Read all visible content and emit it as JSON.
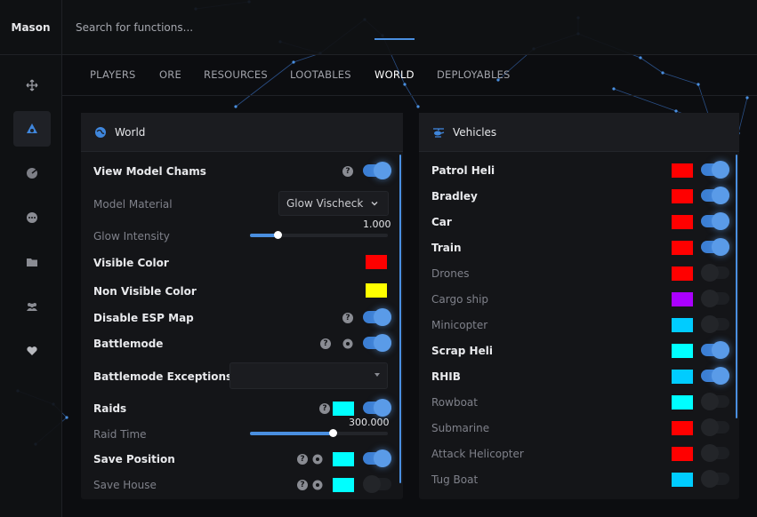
{
  "brand": "Mason",
  "search": {
    "placeholder": "Search for functions..."
  },
  "sidebar": {
    "items": [
      {
        "icon": "move-icon",
        "active": false
      },
      {
        "icon": "eye-icon",
        "active": true
      },
      {
        "icon": "radar-icon",
        "active": false
      },
      {
        "icon": "dots-icon",
        "active": false
      },
      {
        "icon": "folder-icon",
        "active": false
      },
      {
        "icon": "users-icon",
        "active": false
      },
      {
        "icon": "heart-icon",
        "active": false
      }
    ]
  },
  "tabs": [
    "PLAYERS",
    "ORE",
    "RESOURCES",
    "LOOTABLES",
    "WORLD",
    "DEPLOYABLES"
  ],
  "active_tab": "WORLD",
  "colors": {
    "accent": "#4a8fe0",
    "red": "#ff0000",
    "yellow": "#ffff00",
    "cyan": "#00ffff",
    "light_cyan": "#00ccff",
    "purple": "#aa00ff"
  },
  "world": {
    "title": "World",
    "view_model_chams": "View Model Chams",
    "model_material": "Model Material",
    "model_material_value": "Glow Vischeck",
    "glow_intensity": "Glow Intensity",
    "glow_intensity_value": "1.000",
    "glow_intensity_fraction": 0.2,
    "visible_color": "Visible Color",
    "non_visible_color": "Non Visible Color",
    "disable_esp_map": "Disable ESP Map",
    "battlemode": "Battlemode",
    "battlemode_exceptions": "Battlemode Exceptions",
    "raids": "Raids",
    "raid_time": "Raid Time",
    "raid_time_value": "300.000",
    "raid_time_fraction": 0.6,
    "save_position": "Save Position",
    "save_house": "Save House"
  },
  "vehicles": {
    "title": "Vehicles",
    "items": [
      {
        "label": "Patrol Heli",
        "color": "#ff0000",
        "enabled": true
      },
      {
        "label": "Bradley",
        "color": "#ff0000",
        "enabled": true
      },
      {
        "label": "Car",
        "color": "#ff0000",
        "enabled": true
      },
      {
        "label": "Train",
        "color": "#ff0000",
        "enabled": true
      },
      {
        "label": "Drones",
        "color": "#ff0000",
        "enabled": false
      },
      {
        "label": "Cargo ship",
        "color": "#aa00ff",
        "enabled": false
      },
      {
        "label": "Minicopter",
        "color": "#00ccff",
        "enabled": false
      },
      {
        "label": "Scrap Heli",
        "color": "#00ffff",
        "enabled": true
      },
      {
        "label": "RHIB",
        "color": "#00ccff",
        "enabled": true
      },
      {
        "label": "Rowboat",
        "color": "#00ffff",
        "enabled": false
      },
      {
        "label": "Submarine",
        "color": "#ff0000",
        "enabled": false
      },
      {
        "label": "Attack Helicopter",
        "color": "#ff0000",
        "enabled": false
      },
      {
        "label": "Tug Boat",
        "color": "#00ccff",
        "enabled": false
      }
    ]
  }
}
